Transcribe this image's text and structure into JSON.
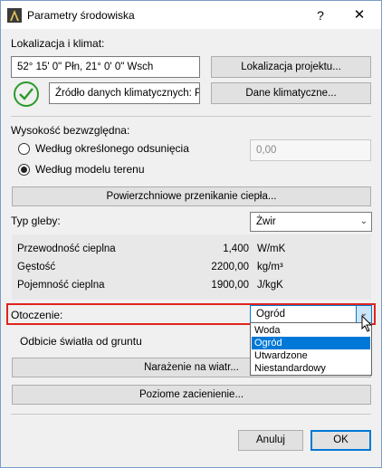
{
  "window": {
    "title": "Parametry środowiska"
  },
  "location": {
    "section_label": "Lokalizacja i klimat:",
    "coordinates": "52° 15' 0\" Płn, 21° 0' 0\" Wsch",
    "project_location_button": "Lokalizacja projektu...",
    "climate_source": "Źródło danych klimatycznych: Pl",
    "climate_data_button": "Dane klimatyczne..."
  },
  "altitude": {
    "section_label": "Wysokość bezwzględna:",
    "option_offset": "Według określonego odsunięcia",
    "offset_value": "0,00",
    "option_terrain": "Według modelu terenu",
    "selected": "terrain"
  },
  "surface_heat_button": "Powierzchniowe przenikanie ciepła...",
  "soil": {
    "label": "Typ gleby:",
    "value": "Żwir",
    "properties": [
      {
        "name": "Przewodność cieplna",
        "value": "1,400",
        "unit": "W/mK"
      },
      {
        "name": "Gęstość",
        "value": "2200,00",
        "unit": "kg/m³"
      },
      {
        "name": "Pojemność cieplna",
        "value": "1900,00",
        "unit": "J/kgK"
      }
    ]
  },
  "surroundings": {
    "label": "Otoczenie:",
    "value": "Ogród",
    "options": [
      "Woda",
      "Ogród",
      "Utwardzone",
      "Niestandardowy"
    ],
    "selected_index": 1
  },
  "ground_reflection_label": "Odbicie światła od gruntu",
  "wind_exposure_button": "Narażenie na wiatr...",
  "horizontal_shading_button": "Poziome zacienienie...",
  "footer": {
    "cancel": "Anuluj",
    "ok": "OK"
  },
  "colors": {
    "highlight": "#e0241d",
    "selection": "#0078d7",
    "ok_border": "#0078d7",
    "check_green": "#2a9b2a"
  }
}
